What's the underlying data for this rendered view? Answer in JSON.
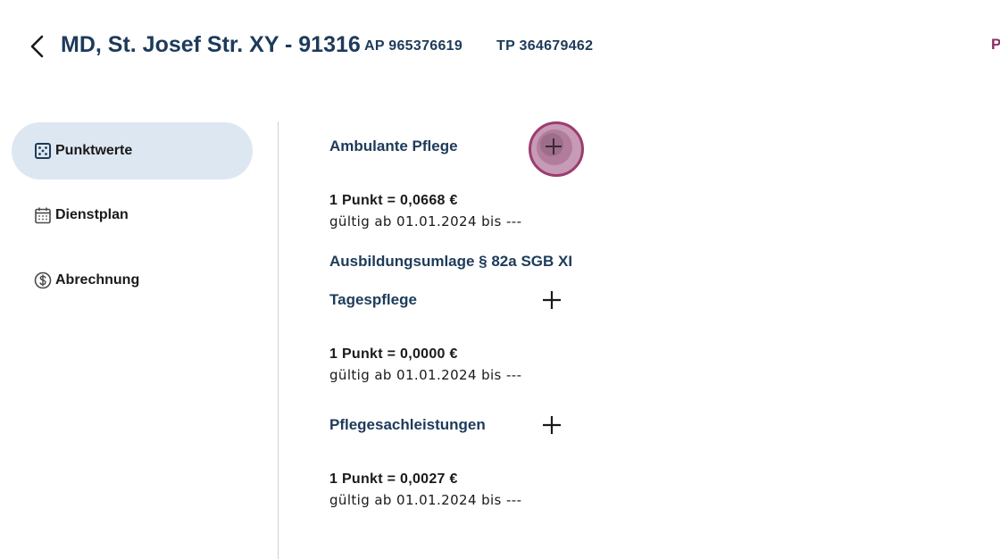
{
  "header": {
    "back_icon": "chevron-left-icon",
    "title": "MD, St. Josef Str. XY - 91316",
    "ap_label": "AP 965376619",
    "tp_label": "TP 364679462",
    "edge_text": "P"
  },
  "sidebar": {
    "items": [
      {
        "label": "Punktwerte",
        "icon": "dice-icon",
        "active": true
      },
      {
        "label": "Dienstplan",
        "icon": "calendar-icon",
        "active": false
      },
      {
        "label": "Abrechnung",
        "icon": "dollar-circle-icon",
        "active": false
      }
    ]
  },
  "sections": [
    {
      "title": "Ambulante Pflege",
      "point_value": "1 Punkt = 0,0668 €",
      "validity": "gültig ab 01.01.2024 bis ---",
      "add_icon": "plus-icon",
      "focused": true
    },
    {
      "title": "Ausbildungsumlage § 82a SGB XI"
    },
    {
      "title": "Tagespflege",
      "point_value": "1 Punkt = 0,0000 €",
      "validity": "gültig ab 01.01.2024 bis ---",
      "add_icon": "plus-icon",
      "focused": false
    },
    {
      "title": "Pflegesachleistungen",
      "point_value": "1 Punkt = 0,0027 €",
      "validity": "gültig ab 01.01.2024 bis ---",
      "add_icon": "plus-icon",
      "focused": false
    }
  ],
  "colors": {
    "primary_text": "#1d3b5a",
    "active_nav_bg": "#dde7f2",
    "focus_ring": "#9b3d6e",
    "accent": "#8b2f63"
  }
}
